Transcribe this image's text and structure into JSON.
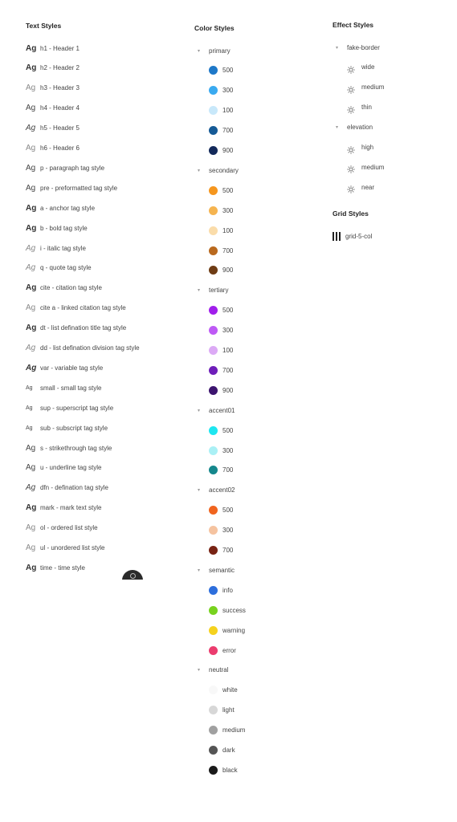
{
  "text_styles": {
    "title": "Text Styles",
    "items": [
      {
        "ag": "Ag",
        "label": "h1 - Header 1"
      },
      {
        "ag": "Ag",
        "label": "h2 - Header 2"
      },
      {
        "ag": "Ag",
        "label": "h3 - Header 3"
      },
      {
        "ag": "Ag",
        "label": "h4 - Header 4"
      },
      {
        "ag": "Ag",
        "label": "h5 - Header 5"
      },
      {
        "ag": "Ag",
        "label": "h6 - Header 6"
      },
      {
        "ag": "Ag",
        "label": "p - paragraph tag style"
      },
      {
        "ag": "Ag",
        "label": "pre - preformatted tag style"
      },
      {
        "ag": "Ag",
        "label": "a - anchor tag style"
      },
      {
        "ag": "Ag",
        "label": "b - bold tag style"
      },
      {
        "ag": "Ag",
        "label": "i - italic tag style"
      },
      {
        "ag": "Ag",
        "label": "q - quote tag style"
      },
      {
        "ag": "Ag",
        "label": "cite - citation tag style"
      },
      {
        "ag": "Ag",
        "label": "cite a - linked citation tag style"
      },
      {
        "ag": "Ag",
        "label": "dt - list defination title tag style"
      },
      {
        "ag": "Ag",
        "label": "dd - list defination division tag style"
      },
      {
        "ag": "Ag",
        "label": "var - variable tag style"
      },
      {
        "ag": "Ag",
        "label": "small - small tag style"
      },
      {
        "ag": "Ag",
        "label": "sup - superscript tag style"
      },
      {
        "ag": "Ag",
        "label": "sub - subscript tag style"
      },
      {
        "ag": "Ag",
        "label": "s - strikethrough tag style"
      },
      {
        "ag": "Ag",
        "label": "u - underline tag style"
      },
      {
        "ag": "Ag",
        "label": "dfn - defination tag style"
      },
      {
        "ag": "Ag",
        "label": "mark - mark text style"
      },
      {
        "ag": "Ag",
        "label": "ol - ordered list style"
      },
      {
        "ag": "Ag",
        "label": "ul - unordered list style"
      },
      {
        "ag": "Ag",
        "label": "time - time style"
      }
    ]
  },
  "color_styles": {
    "title": "Color Styles",
    "groups": [
      {
        "name": "primary",
        "swatches": [
          {
            "label": "500",
            "color": "#1e78c8"
          },
          {
            "label": "300",
            "color": "#3aaaf0"
          },
          {
            "label": "100",
            "color": "#c8e8fa"
          },
          {
            "label": "700",
            "color": "#155a96"
          },
          {
            "label": "900",
            "color": "#13295a"
          }
        ]
      },
      {
        "name": "secondary",
        "swatches": [
          {
            "label": "500",
            "color": "#f5961e"
          },
          {
            "label": "300",
            "color": "#f5b450"
          },
          {
            "label": "100",
            "color": "#fadcaa"
          },
          {
            "label": "700",
            "color": "#b9691e"
          },
          {
            "label": "900",
            "color": "#6e3c14"
          }
        ]
      },
      {
        "name": "tertiary",
        "swatches": [
          {
            "label": "500",
            "color": "#a01eeb"
          },
          {
            "label": "300",
            "color": "#be5af5"
          },
          {
            "label": "100",
            "color": "#dcaaf5"
          },
          {
            "label": "700",
            "color": "#6e1eb9"
          },
          {
            "label": "900",
            "color": "#3c146e"
          }
        ]
      },
      {
        "name": "accent01",
        "swatches": [
          {
            "label": "500",
            "color": "#1ee6f0"
          },
          {
            "label": "300",
            "color": "#aaf0f5"
          },
          {
            "label": "700",
            "color": "#14878c"
          }
        ]
      },
      {
        "name": "accent02",
        "swatches": [
          {
            "label": "500",
            "color": "#f0641e"
          },
          {
            "label": "300",
            "color": "#f5c3a0"
          },
          {
            "label": "700",
            "color": "#782314"
          }
        ]
      },
      {
        "name": "semantic",
        "swatches": [
          {
            "label": "info",
            "color": "#2d6edc"
          },
          {
            "label": "success",
            "color": "#78d21e"
          },
          {
            "label": "warning",
            "color": "#f5d21e"
          },
          {
            "label": "error",
            "color": "#eb3c6e"
          }
        ]
      },
      {
        "name": "neutral",
        "swatches": [
          {
            "label": "white",
            "color": "#f8f8f8"
          },
          {
            "label": "light",
            "color": "#d7d7d7"
          },
          {
            "label": "medium",
            "color": "#a0a0a0"
          },
          {
            "label": "dark",
            "color": "#555555"
          },
          {
            "label": "black",
            "color": "#1a1a1a"
          }
        ]
      }
    ]
  },
  "effect_styles": {
    "title": "Effect Styles",
    "groups": [
      {
        "name": "fake-border",
        "items": [
          "wide",
          "medium",
          "thin"
        ]
      },
      {
        "name": "elevation",
        "items": [
          "high",
          "medium",
          "near"
        ]
      }
    ]
  },
  "grid_styles": {
    "title": "Grid Styles",
    "items": [
      "grid-5-col"
    ]
  }
}
